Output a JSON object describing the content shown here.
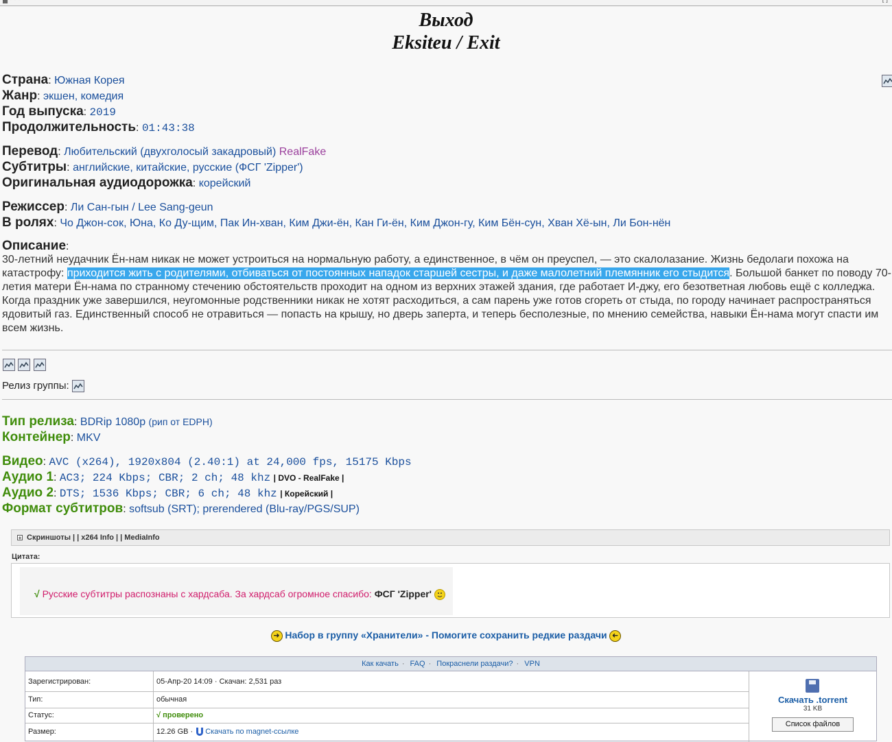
{
  "top_bar": {
    "left_text": "▄ ▪ ▪ ▪",
    "right_text": "[ ]"
  },
  "title": {
    "line1": "Выход",
    "line2": "Eksiteu / Exit"
  },
  "info": {
    "country_label": "Страна",
    "country": "Южная Корея",
    "genre_label": "Жанр",
    "genre": "экшен, комедия",
    "year_label": "Год выпуска",
    "year": "2019",
    "duration_label": "Продолжительность",
    "duration": "01:43:38",
    "translation_label": "Перевод",
    "translation": "Любительский (двухголосый закадровый)",
    "translation_author": "RealFake",
    "subtitles_label": "Субтитры",
    "subtitles": "английские, китайские, русские (ФСГ 'Zipper')",
    "audio_orig_label": "Оригинальная аудиодорожка",
    "audio_orig": "корейский",
    "director_label": "Режиссер",
    "director": "Ли Сан-гын / Lee Sang-geun",
    "cast_label": "В ролях",
    "cast": "Чо Джон-сок, Юна, Ко Ду-щим, Пак Ин-хван, Ким Джи-ён, Кан Ги-ён, Ким Джон-гу, Ким Бён-сун, Хван Хё-ын, Ли Бон-нён",
    "description_label": "Описание",
    "description_before": "30-летний неудачник Ён-нам никак не может устроиться на нормальную работу, а единственное, в чём он преуспел, — это скалолазание. Жизнь бедолаги похожа на катастрофу: ",
    "description_highlight": "приходится жить с родителями, отбиваться от постоянных нападок старшей сестры, и даже малолетний племянник его стыдится",
    "description_after": ". Большой банкет по поводу 70-летия матери Ён-нама по странному стечению обстоятельств проходит на одном из верхних этажей здания, где работает И-джу, его безответная любовь ещё с колледжа. Когда праздник уже завершился, неугомонные родственники никак не хотят расходиться, а сам парень уже готов сгореть от стыда, по городу начинает распространяться ядовитый газ. Единственный способ не отравиться — попасть на крышу, но дверь заперта, и теперь бесполезные, по мнению семейства, навыки Ён-нама могут спасти им всем жизнь."
  },
  "release_group_label": "Релиз группы:",
  "tech": {
    "type_label": "Тип релиза",
    "type": "BDRip 1080p",
    "type_note": "(рип от EDPH)",
    "container_label": "Контейнер",
    "container": "MKV",
    "video_label": "Видео",
    "video": "AVC (x264), 1920x804 (2.40:1) at 24,000 fps, 15175 Kbps",
    "audio1_label": "Аудио 1",
    "audio1": "AC3; 224 Kbps; CBR; 2 ch; 48 khz",
    "audio1_note": "| DVO - RealFake |",
    "audio2_label": "Аудио 2",
    "audio2": "DTS; 1536 Kbps; CBR; 6 ch; 48 khz",
    "audio2_note": "| Корейский |",
    "subs_label": "Формат субтитров",
    "subs": "softsub (SRT); prerendered (Blu-ray/PGS/SUP)"
  },
  "spoiler": {
    "plus": "+",
    "text": "Скриншоты | | x264 Info | | MediaInfo"
  },
  "quote": {
    "label": "Цитата:",
    "check": "√",
    "text": "Русские субтитры распознаны с хардсаба. За хардсаб огромное спасибо:",
    "author": "ФСГ 'Zipper'"
  },
  "keepers": {
    "text": "Набор в группу «Хранители» - Помогите сохранить редкие раздачи"
  },
  "download": {
    "links": [
      "Как качать",
      "FAQ",
      "Покраснели раздачи?",
      "VPN"
    ],
    "registered_label": "Зарегистрирован:",
    "registered": "05-Апр-20 14:09",
    "downloaded": "Скачан: 2,531 раз",
    "type_label": "Тип:",
    "type": "обычная",
    "status_label": "Статус:",
    "status_check": "√",
    "status": "проверено",
    "size_label": "Размер:",
    "size": "12.26 GB",
    "magnet": "Скачать по magnet-ссылке",
    "torrent_link": "Скачать .torrent",
    "torrent_size": "31 KB",
    "files_button": "Список файлов"
  },
  "colors": {
    "link": "#1a4f9c",
    "green_label": "#3f8c0a",
    "highlight": "#39a7ec",
    "pink": "#d01c6b"
  }
}
